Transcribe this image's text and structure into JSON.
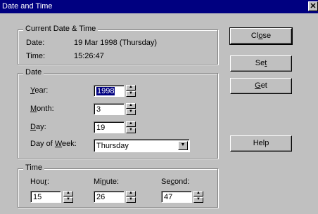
{
  "window": {
    "title": "Date and Time",
    "close_glyph": "✕"
  },
  "current": {
    "legend": "Current Date & Time",
    "date_label": "Date:",
    "date_value": "19 Mar 1998 (Thursday)",
    "time_label": "Time:",
    "time_value": "15:26:47"
  },
  "date_group": {
    "legend": "Date",
    "year_label": {
      "pre": "",
      "u": "Y",
      "post": "ear:"
    },
    "year_value": "1998",
    "month_label": {
      "pre": "",
      "u": "M",
      "post": "onth:"
    },
    "month_value": "3",
    "day_label": {
      "pre": "",
      "u": "D",
      "post": "ay:"
    },
    "day_value": "19",
    "dow_label": {
      "pre": "Day of ",
      "u": "W",
      "post": "eek:"
    },
    "dow_value": "Thursday"
  },
  "time_group": {
    "legend": "Time",
    "hour_label": {
      "pre": "Hou",
      "u": "r",
      "post": ":"
    },
    "hour_value": "15",
    "minute_label": {
      "pre": "Mi",
      "u": "n",
      "post": "ute:"
    },
    "minute_value": "26",
    "second_label": {
      "pre": "Se",
      "u": "c",
      "post": "ond:"
    },
    "second_value": "47"
  },
  "buttons": {
    "close": {
      "pre": "Cl",
      "u": "o",
      "post": "se"
    },
    "set": {
      "pre": "Se",
      "u": "t",
      "post": ""
    },
    "get": {
      "pre": "",
      "u": "G",
      "post": "et"
    },
    "help": {
      "pre": "Help",
      "u": "",
      "post": ""
    }
  },
  "icons": {
    "spin_up": "spin-up-arrow",
    "spin_down": "spin-down-arrow",
    "combo": "dropdown-arrow"
  }
}
